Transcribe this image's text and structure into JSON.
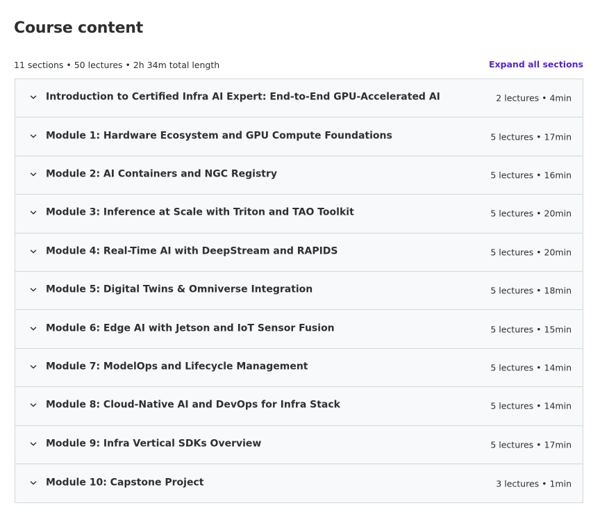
{
  "header": {
    "title": "Course content",
    "summary": "11 sections • 50 lectures • 2h 34m total length",
    "expand_label": "Expand all sections"
  },
  "colors": {
    "accent": "#5624d0",
    "row_bg": "#f7f9fa",
    "border": "#d1d7dc",
    "text": "#2d2f31"
  },
  "sections": [
    {
      "title": "Introduction to Certified Infra AI Expert: End-to-End GPU-Accelerated AI",
      "meta": "2 lectures • 4min",
      "icon": "chevron-down-icon"
    },
    {
      "title": "Module 1: Hardware Ecosystem and GPU Compute Foundations",
      "meta": "5 lectures • 17min",
      "icon": "chevron-down-icon"
    },
    {
      "title": "Module 2: AI Containers and NGC Registry",
      "meta": "5 lectures • 16min",
      "icon": "chevron-down-icon"
    },
    {
      "title": "Module 3: Inference at Scale with Triton and TAO Toolkit",
      "meta": "5 lectures • 20min",
      "icon": "chevron-down-icon"
    },
    {
      "title": "Module 4: Real-Time AI with DeepStream and RAPIDS",
      "meta": "5 lectures • 20min",
      "icon": "chevron-down-icon"
    },
    {
      "title": "Module 5: Digital Twins & Omniverse Integration",
      "meta": "5 lectures • 18min",
      "icon": "chevron-down-icon"
    },
    {
      "title": "Module 6: Edge AI with Jetson and IoT Sensor Fusion",
      "meta": "5 lectures • 15min",
      "icon": "chevron-down-icon"
    },
    {
      "title": "Module 7: ModelOps and Lifecycle Management",
      "meta": "5 lectures • 14min",
      "icon": "chevron-down-icon"
    },
    {
      "title": "Module 8: Cloud-Native AI and DevOps for Infra Stack",
      "meta": "5 lectures • 14min",
      "icon": "chevron-down-icon"
    },
    {
      "title": "Module 9: Infra Vertical SDKs Overview",
      "meta": "5 lectures • 17min",
      "icon": "chevron-down-icon"
    },
    {
      "title": "Module 10: Capstone Project",
      "meta": "3 lectures • 1min",
      "icon": "chevron-down-icon"
    }
  ]
}
